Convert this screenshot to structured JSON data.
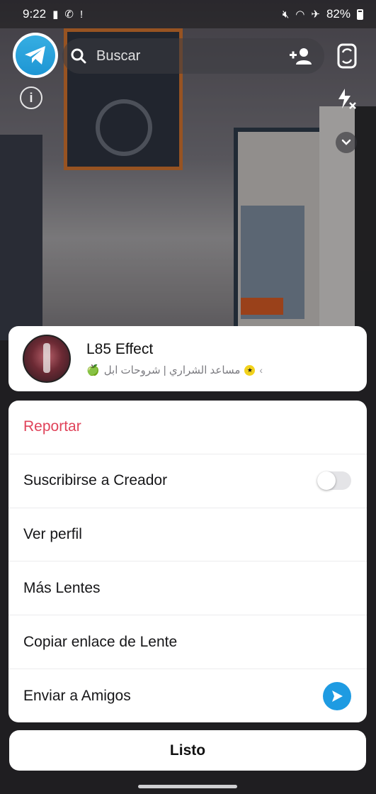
{
  "status_bar": {
    "time": "9:22",
    "battery": "82%"
  },
  "camera": {
    "search_placeholder": "Buscar"
  },
  "lens": {
    "name": "L85 Effect",
    "creator": "مساعد الشراري | شروحات ابل"
  },
  "menu": {
    "items": [
      {
        "label": "Reportar",
        "type": "destructive"
      },
      {
        "label": "Suscribirse a Creador",
        "type": "toggle",
        "toggle_on": false
      },
      {
        "label": "Ver perfil",
        "type": "plain"
      },
      {
        "label": "Más Lentes",
        "type": "plain"
      },
      {
        "label": "Copiar enlace de Lente",
        "type": "plain"
      },
      {
        "label": "Enviar a Amigos",
        "type": "send"
      }
    ]
  },
  "done_label": "Listo",
  "icons": {
    "app_avatar": "telegram-icon",
    "search": "search-icon",
    "add_friend": "add-friend-icon",
    "flip_camera": "flip-camera-icon",
    "info": "info-icon",
    "flash": "flash-off-icon",
    "more": "chevron-down-icon",
    "send": "send-arrow-icon"
  },
  "colors": {
    "report_red": "#e0435a",
    "send_blue": "#1e9be2",
    "telegram_blue": "#2aa3dc"
  }
}
